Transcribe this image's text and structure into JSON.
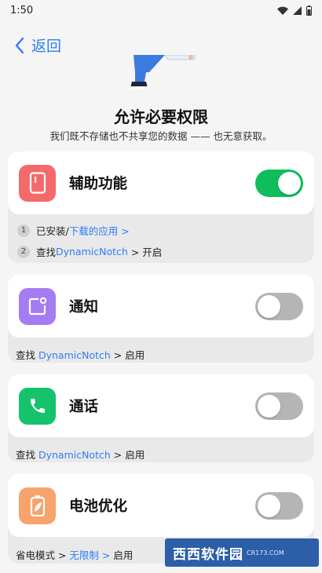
{
  "status": {
    "time": "1:50"
  },
  "nav": {
    "back_label": "返回"
  },
  "header": {
    "title": "允许必要权限",
    "subtitle": "我们既不存储也不共享您的数据 —— 也无意获取。"
  },
  "permissions": [
    {
      "label": "辅助功能",
      "enabled": true,
      "icon": "phone-frame-icon",
      "icon_color": "#f46a6a",
      "steps": [
        {
          "num": "1",
          "text": "已安装/",
          "link": "下载的应用 >",
          "suffix": ""
        },
        {
          "num": "2",
          "text": "查找 ",
          "link": "DynamicNotch",
          "suffix": " > 开启"
        }
      ]
    },
    {
      "label": "通知",
      "enabled": false,
      "icon": "notification-icon",
      "icon_color": "#a57cf2",
      "hint": {
        "text": "查找 ",
        "link": "DynamicNotch",
        "suffix": " > 启用"
      }
    },
    {
      "label": "通话",
      "enabled": false,
      "icon": "phone-icon",
      "icon_color": "#14c36a",
      "hint": {
        "text": "查找 ",
        "link": "DynamicNotch",
        "suffix": " > 启用"
      }
    },
    {
      "label": "电池优化",
      "enabled": false,
      "icon": "battery-leaf-icon",
      "icon_color": "#f7a36b",
      "hint": {
        "text": "省电模式 > ",
        "link": "无限制 >",
        "suffix": " 启用"
      }
    }
  ],
  "watermark": {
    "text": "西西软件园",
    "sub": "CR173.COM"
  },
  "colors": {
    "accent": "#2f7df6",
    "toggle_on": "#0fbe5b",
    "toggle_off": "#b5b5b5"
  }
}
